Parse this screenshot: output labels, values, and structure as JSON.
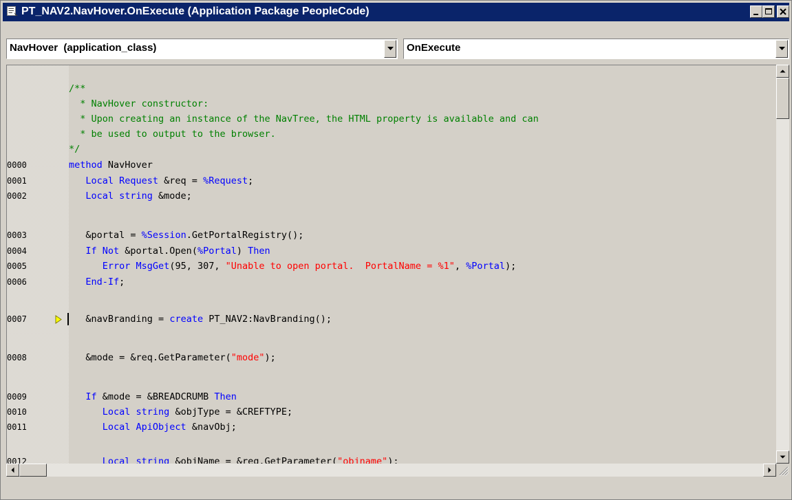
{
  "window": {
    "title": "PT_NAV2.NavHover.OnExecute (Application Package PeopleCode)",
    "icon": "peoplecode-document-icon",
    "controls": [
      "minimize-icon",
      "maximize-icon",
      "close-icon"
    ]
  },
  "toolbar": {
    "object_selector": "NavHover  (application_class)",
    "event_selector": "OnExecute"
  },
  "colors": {
    "title_bar": "#0a246a",
    "comment": "#008000",
    "keyword": "#0000ff",
    "string": "#ff0000",
    "breakpoint_marker": "#ffff00"
  },
  "code_lines": [
    {
      "num": "",
      "segs": []
    },
    {
      "num": "",
      "segs": [
        {
          "t": "/**",
          "c": "cm"
        }
      ]
    },
    {
      "num": "",
      "segs": [
        {
          "t": "  * NavHover constructor:",
          "c": "cm"
        }
      ]
    },
    {
      "num": "",
      "segs": [
        {
          "t": "  * Upon creating an instance of the NavTree, the HTML property is available and can",
          "c": "cm"
        }
      ]
    },
    {
      "num": "",
      "segs": [
        {
          "t": "  * be used to output to the browser.",
          "c": "cm"
        }
      ]
    },
    {
      "num": "",
      "segs": [
        {
          "t": "*/",
          "c": "cm"
        }
      ]
    },
    {
      "num": "0000",
      "segs": [
        {
          "t": "method ",
          "c": "kw"
        },
        {
          "t": "NavHover",
          "c": ""
        }
      ]
    },
    {
      "num": "0001",
      "segs": [
        {
          "t": "   Local Request ",
          "c": "kw"
        },
        {
          "t": "&req = ",
          "c": ""
        },
        {
          "t": "%Request",
          "c": "kw"
        },
        {
          "t": ";",
          "c": ""
        }
      ]
    },
    {
      "num": "0002",
      "segs": [
        {
          "t": "   Local string ",
          "c": "kw"
        },
        {
          "t": "&mode;",
          "c": ""
        }
      ]
    },
    {
      "num": "",
      "segs": []
    },
    {
      "num": "0003",
      "segs": [
        {
          "t": "   &portal = ",
          "c": ""
        },
        {
          "t": "%Session",
          "c": "kw"
        },
        {
          "t": ".GetPortalRegistry();",
          "c": ""
        }
      ]
    },
    {
      "num": "0004",
      "segs": [
        {
          "t": "   If Not ",
          "c": "kw"
        },
        {
          "t": "&portal.Open(",
          "c": ""
        },
        {
          "t": "%Portal",
          "c": "kw"
        },
        {
          "t": ") ",
          "c": ""
        },
        {
          "t": "Then",
          "c": "kw"
        }
      ]
    },
    {
      "num": "0005",
      "segs": [
        {
          "t": "      Error MsgGet",
          "c": "kw"
        },
        {
          "t": "(95, 307, ",
          "c": ""
        },
        {
          "t": "\"Unable to open portal.  PortalName = %1\"",
          "c": "st"
        },
        {
          "t": ", ",
          "c": ""
        },
        {
          "t": "%Portal",
          "c": "kw"
        },
        {
          "t": ");",
          "c": ""
        }
      ]
    },
    {
      "num": "0006",
      "segs": [
        {
          "t": "   End-If",
          "c": "kw"
        },
        {
          "t": ";",
          "c": ""
        }
      ]
    },
    {
      "num": "",
      "segs": []
    },
    {
      "num": "0007",
      "marker": true,
      "segs": [
        {
          "t": "   &navBranding = ",
          "c": ""
        },
        {
          "t": "create ",
          "c": "kw"
        },
        {
          "t": "PT_NAV2:NavBranding();",
          "c": ""
        }
      ]
    },
    {
      "num": "",
      "segs": []
    },
    {
      "num": "0008",
      "segs": [
        {
          "t": "   &mode = &req.GetParameter(",
          "c": ""
        },
        {
          "t": "\"mode\"",
          "c": "st"
        },
        {
          "t": ");",
          "c": ""
        }
      ]
    },
    {
      "num": "",
      "segs": []
    },
    {
      "num": "0009",
      "segs": [
        {
          "t": "   If ",
          "c": "kw"
        },
        {
          "t": "&mode = &BREADCRUMB ",
          "c": ""
        },
        {
          "t": "Then",
          "c": "kw"
        }
      ]
    },
    {
      "num": "0010",
      "segs": [
        {
          "t": "      Local string ",
          "c": "kw"
        },
        {
          "t": "&objType = &CREFTYPE;",
          "c": ""
        }
      ]
    },
    {
      "num": "0011",
      "segs": [
        {
          "t": "      Local ApiObject ",
          "c": "kw"
        },
        {
          "t": "&navObj;",
          "c": ""
        }
      ]
    },
    {
      "num": "",
      "segs": []
    },
    {
      "num": "0012",
      "segs": [
        {
          "t": "      Local string ",
          "c": "kw"
        },
        {
          "t": "&objName = &req.GetParameter(",
          "c": ""
        },
        {
          "t": "\"objname\"",
          "c": "st"
        },
        {
          "t": ");",
          "c": ""
        }
      ]
    }
  ]
}
